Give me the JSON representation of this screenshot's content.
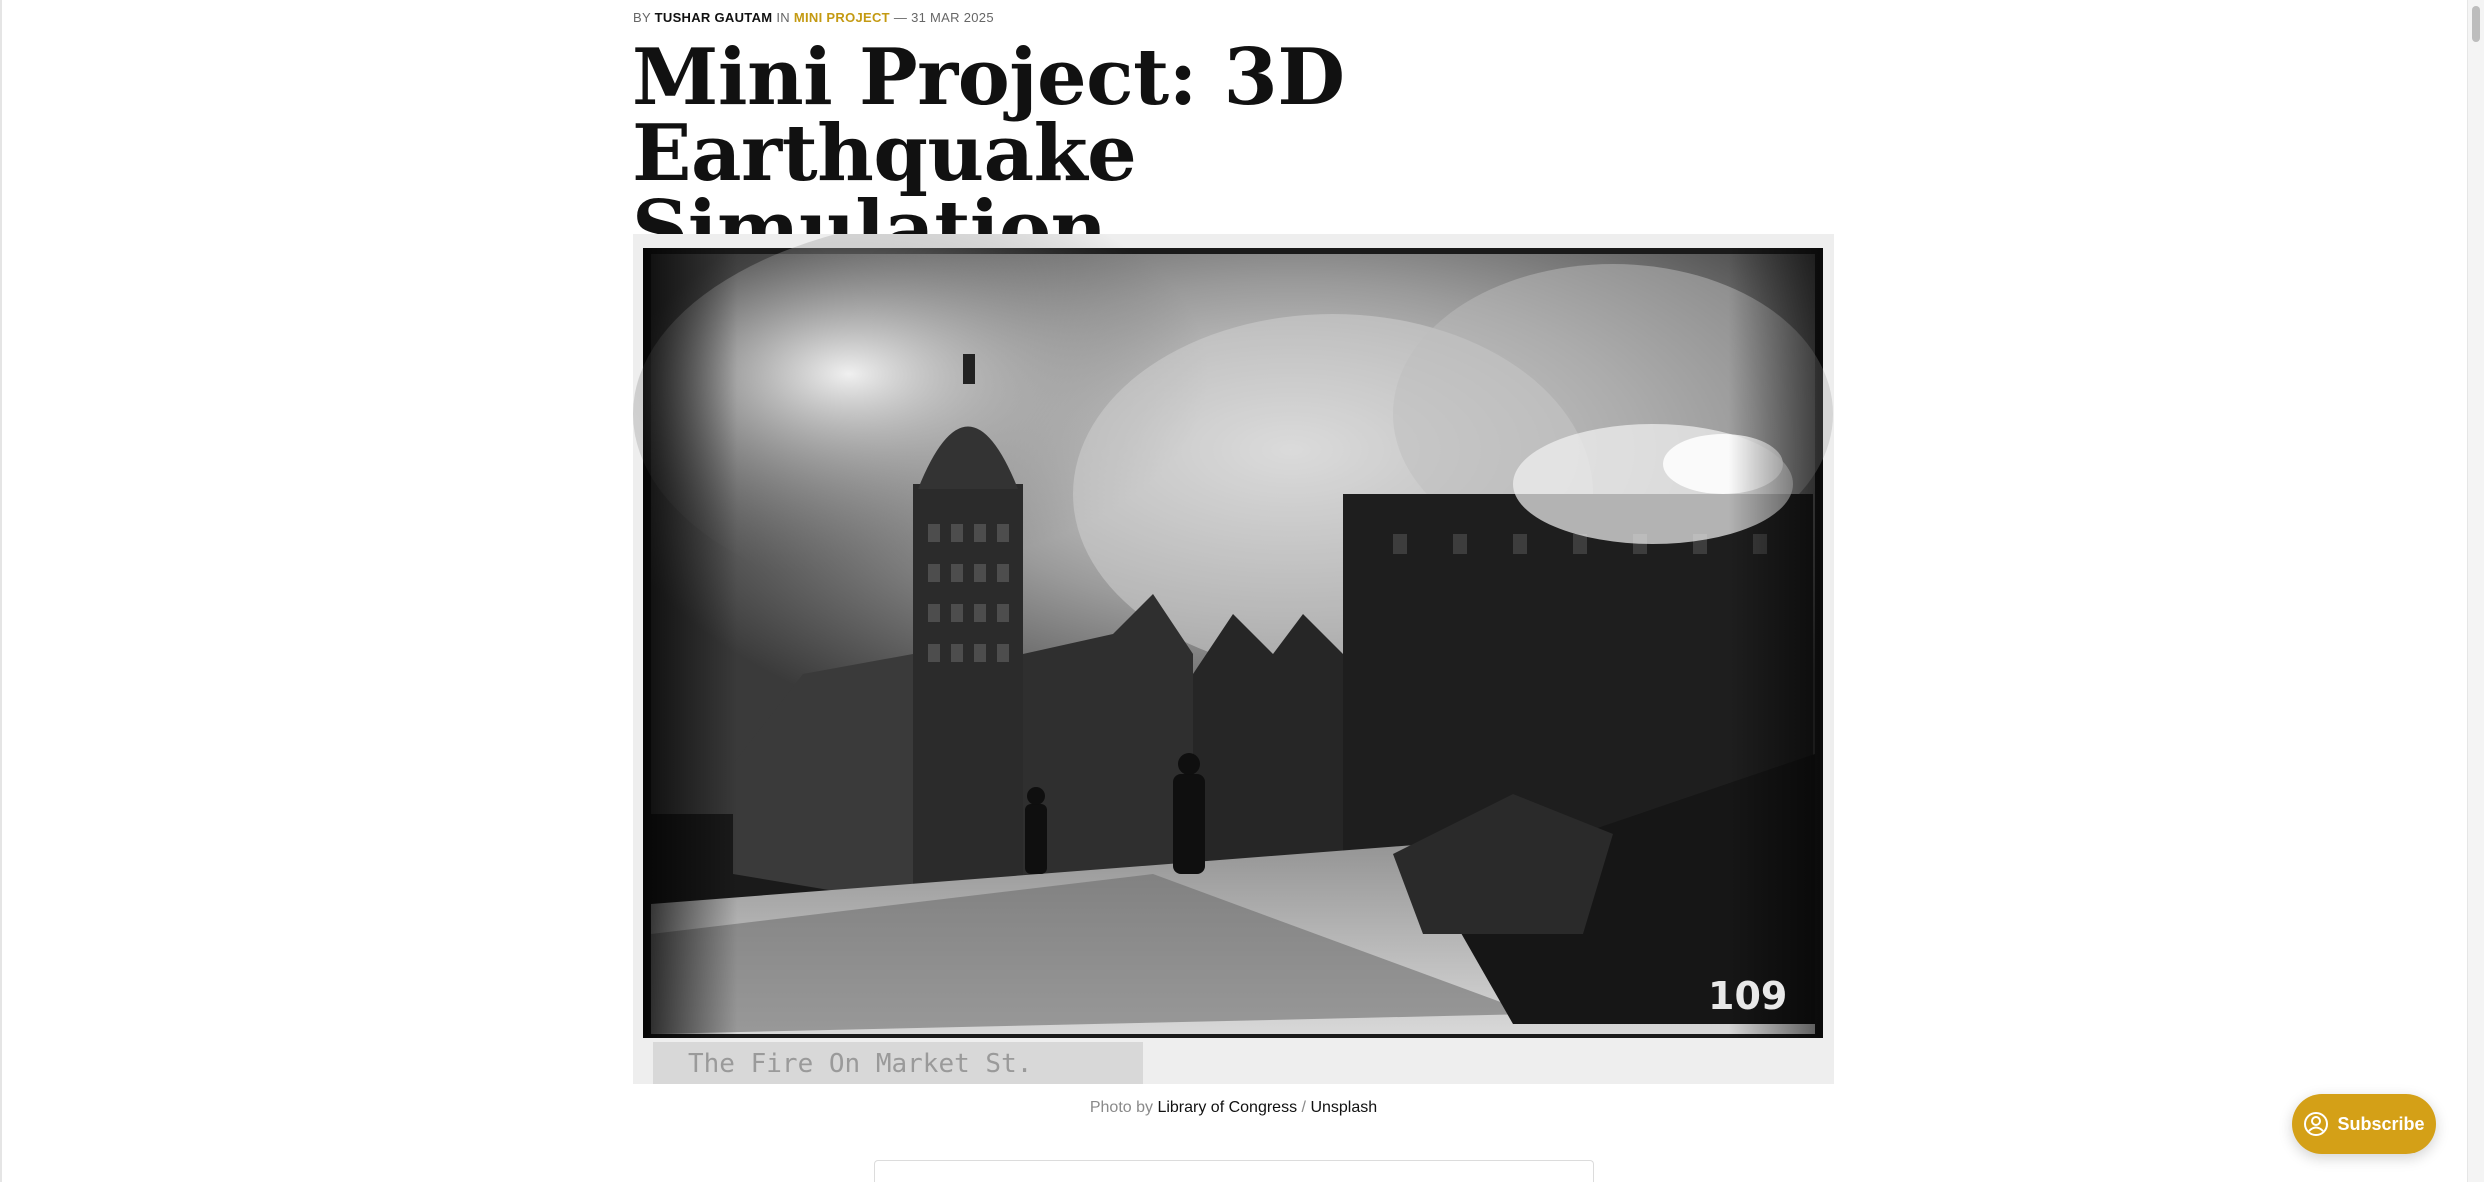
{
  "byline": {
    "by": "BY",
    "author": "TUSHAR GAUTAM",
    "in": "IN",
    "tag": "MINI PROJECT",
    "date_prefix": "—",
    "date": "31 MAR 2025"
  },
  "article": {
    "title_line1": "Mini Project: 3D Earthquake",
    "title_line2": "Simulation"
  },
  "feature_image": {
    "alt": "Black and white photograph of a city street on fire after an earthquake",
    "plate_number": "109",
    "plate_caption": "The Fire On Market St."
  },
  "caption": {
    "prefix": "Photo by",
    "credit": "Library of Congress",
    "separator": "/",
    "source": "Unsplash"
  },
  "subscribe": {
    "label": "Subscribe",
    "icon": "portal-icon"
  },
  "colors": {
    "accent": "#d4a017",
    "tag": "#c49a12",
    "text": "#111111",
    "muted": "#8a8a8a"
  }
}
